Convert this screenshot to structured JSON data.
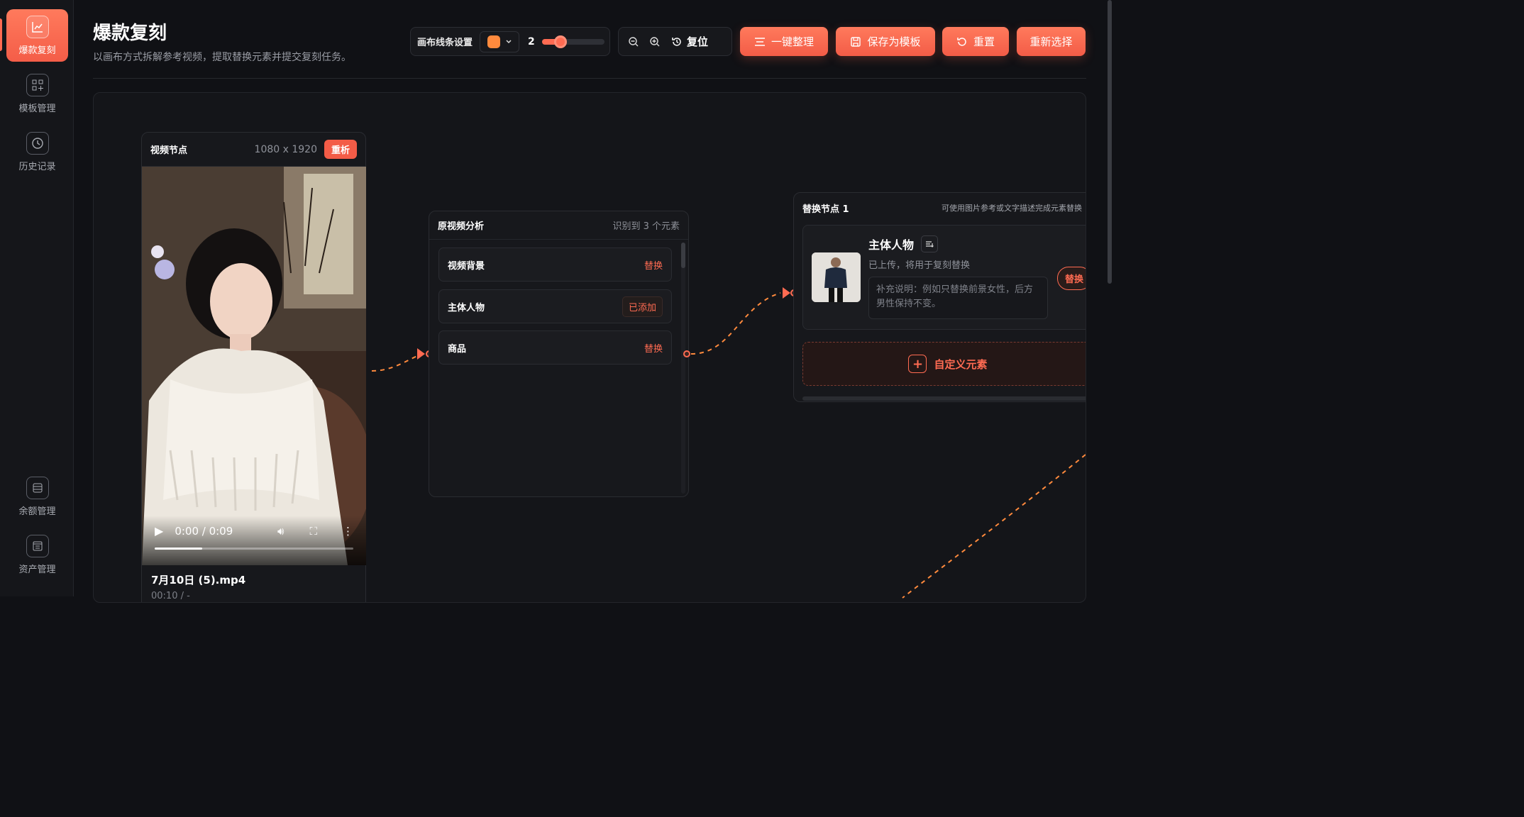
{
  "sidebar": {
    "items": [
      {
        "label": "爆款复刻",
        "icon": "chart-line-icon"
      },
      {
        "label": "模板管理",
        "icon": "grid-plus-icon"
      },
      {
        "label": "历史记录",
        "icon": "clock-icon"
      },
      {
        "label": "余额管理",
        "icon": "wallet-icon"
      },
      {
        "label": "资产管理",
        "icon": "archive-icon"
      }
    ]
  },
  "header": {
    "title": "爆款复刻",
    "subtitle": "以画布方式拆解参考视频，提取替换元素并提交复刻任务。"
  },
  "toolbar": {
    "line_label": "画布线条设置",
    "line_color": "#ff8a3d",
    "line_width": "2",
    "line_width_fraction": 0.3,
    "reset_label": "复位",
    "organize_label": "一键整理",
    "save_template_label": "保存为模板",
    "reset_all_label": "重置",
    "reselect_label": "重新选择"
  },
  "video_node": {
    "title": "视频节点",
    "resolution": "1080 x 1920",
    "reanalyze_label": "重析",
    "time": "0:00 / 0:09",
    "progress_fraction": 0.24,
    "filename": "7月10日 (5).mp4",
    "duration": "00:10 / -"
  },
  "analysis_node": {
    "title": "原视频分析",
    "count_text": "识别到 3 个元素",
    "elements": [
      {
        "name": "视频背景",
        "action": "替换"
      },
      {
        "name": "主体人物",
        "action": "已添加"
      },
      {
        "name": "商品",
        "action": "替换"
      }
    ]
  },
  "replace_node": {
    "title": "替换节点 1",
    "hint": "可使用图片参考或文字描述完成元素替换",
    "card_title": "主体人物",
    "card_status": "已上传，将用于复刻替换",
    "replace_label": "替换",
    "textarea_placeholder": "补充说明：例如只替换前景女性，后方男性保持不变。",
    "custom_label": "自定义元素"
  },
  "colors": {
    "accent": "#ff6b52",
    "background": "#101115"
  }
}
